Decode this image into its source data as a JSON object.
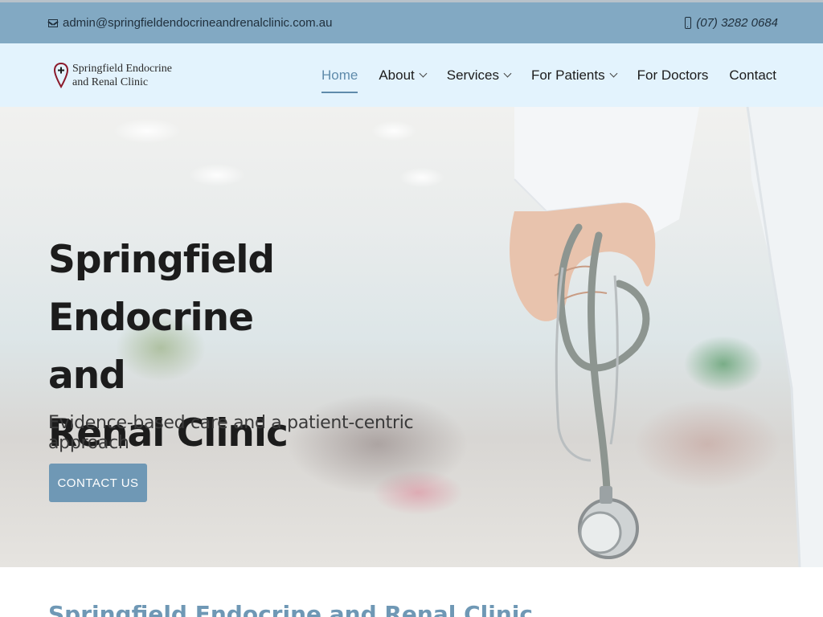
{
  "topbar": {
    "email": "admin@springfieldendocrineandrenalclinic.com.au",
    "phone": "(07) 3282 0684"
  },
  "brand": {
    "line1": "Springfield Endocrine",
    "line2": "and Renal Clinic"
  },
  "nav": {
    "items": [
      {
        "label": "Home",
        "active": true,
        "dropdown": false
      },
      {
        "label": "About",
        "active": false,
        "dropdown": true
      },
      {
        "label": "Services",
        "active": false,
        "dropdown": true
      },
      {
        "label": "For Patients",
        "active": false,
        "dropdown": true
      },
      {
        "label": "For Doctors",
        "active": false,
        "dropdown": false
      },
      {
        "label": "Contact",
        "active": false,
        "dropdown": false
      }
    ]
  },
  "hero": {
    "title_line1": "Springfield Endocrine",
    "title_line2": "and",
    "title_line3": "Renal Clinic",
    "subtitle": "Evidence-based care and a patient-centric approach",
    "cta_label": "CONTACT US"
  },
  "section": {
    "heading": "Springfield Endocrine and Renal Clinic"
  },
  "colors": {
    "topbar": "#82a9c3",
    "header": "#e3f3fd",
    "accent": "#6f98b5",
    "logo_pin": "#8b1a2b"
  },
  "icons": {
    "email": "envelope-icon",
    "phone": "mobile-icon",
    "logo": "location-pin-cross-icon",
    "dropdown": "chevron-down-icon"
  }
}
